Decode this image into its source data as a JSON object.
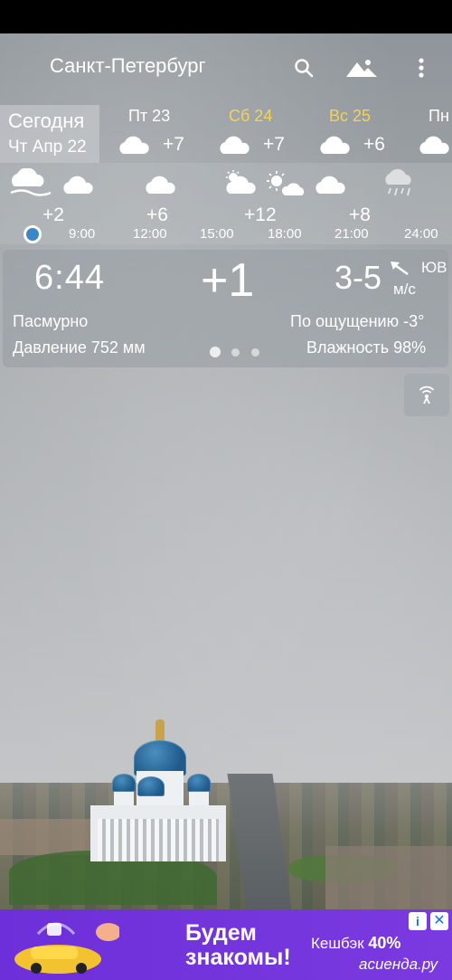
{
  "header": {
    "city": "Санкт-Петербург",
    "icons": [
      "search-icon",
      "landscape-icon",
      "more-vert-icon"
    ]
  },
  "days": {
    "today": {
      "label": "Сегодня",
      "date": "Чт Апр 22"
    },
    "items": [
      {
        "name": "Пт 23",
        "temp": "+7",
        "icon": "cloud-icon",
        "weekend": false
      },
      {
        "name": "Сб 24",
        "temp": "+7",
        "icon": "cloud-icon",
        "weekend": true
      },
      {
        "name": "Вс 25",
        "temp": "+6",
        "icon": "cloud-icon",
        "weekend": true
      },
      {
        "name": "Пн",
        "temp": "",
        "icon": "cloud-icon",
        "weekend": false
      }
    ]
  },
  "hourly": {
    "temps": [
      "+2",
      "+6",
      "+12",
      "+8"
    ],
    "times": [
      "9:00",
      "12:00",
      "15:00",
      "18:00",
      "21:00",
      "24:00"
    ]
  },
  "current": {
    "time": "6:44",
    "temp": "+1",
    "wind_speed": "3-5",
    "wind_dir": "ЮВ",
    "wind_unit": "м/с",
    "condition": "Пасмурно",
    "feels_like": "По ощущению -3°",
    "pressure": "Давление 752 мм",
    "humidity": "Влажность 98%",
    "page_count": 3,
    "active_page": 1
  },
  "ad": {
    "line1": "Будем",
    "line2": "знакомы!",
    "cashback": "Кешбэк",
    "cashback_pct": "40%",
    "brand": "асиенда.ру",
    "info_label": "i",
    "close_label": "✕"
  },
  "colors": {
    "weekend": "#f4d25a",
    "ad_bg": "#6d2fd9",
    "now_dot": "#3b86c6"
  }
}
